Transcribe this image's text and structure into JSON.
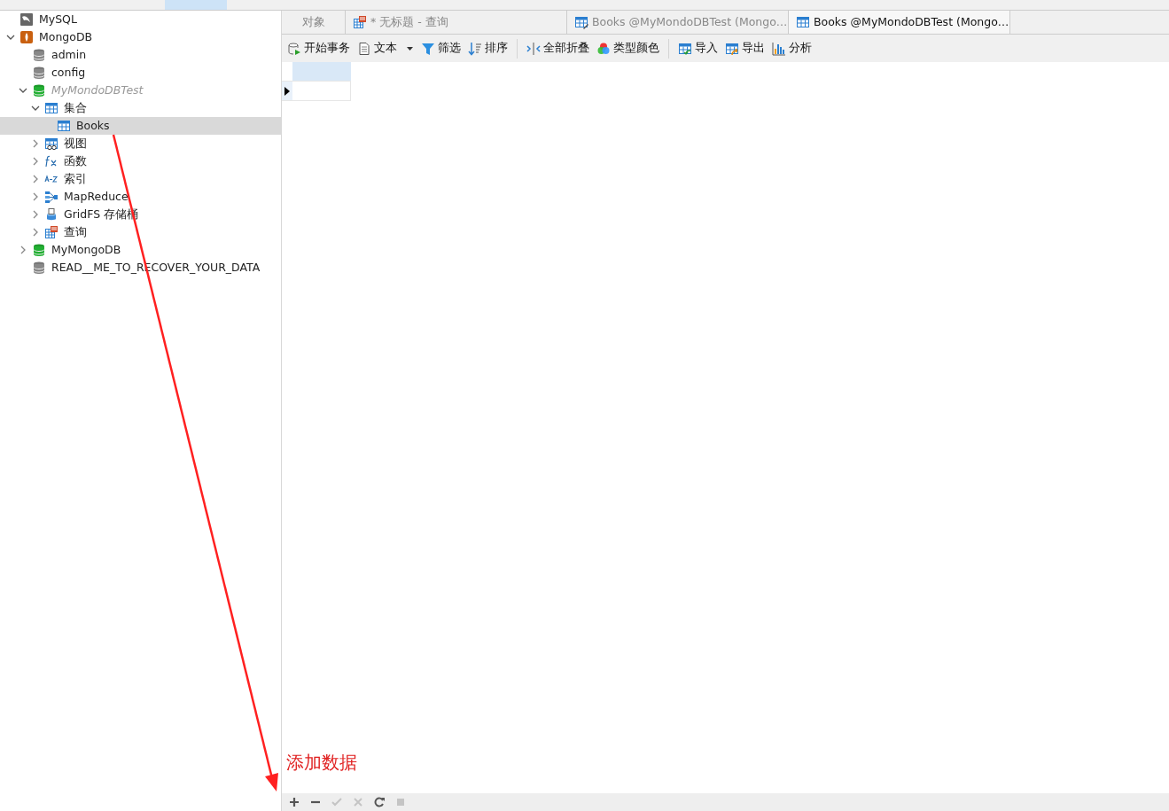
{
  "tree": [
    {
      "label": "MySQL",
      "kind": "mysql"
    },
    {
      "label": "MongoDB",
      "kind": "mongo",
      "expanded": true,
      "children": [
        {
          "label": "admin",
          "kind": "db"
        },
        {
          "label": "config",
          "kind": "db"
        },
        {
          "label": "MyMondoDBTest",
          "kind": "db-open",
          "dimmed": true,
          "expanded": true,
          "children": [
            {
              "label": "集合",
              "kind": "table",
              "expanded": true,
              "children": [
                {
                  "label": "Books",
                  "kind": "table",
                  "selected": true
                }
              ]
            },
            {
              "label": "视图",
              "kind": "view",
              "expanded": false
            },
            {
              "label": "函数",
              "kind": "function",
              "expanded": false
            },
            {
              "label": "索引",
              "kind": "index",
              "expanded": false
            },
            {
              "label": "MapReduce",
              "kind": "mapreduce",
              "expanded": false
            },
            {
              "label": "GridFS 存储桶",
              "kind": "gridfs",
              "expanded": false
            },
            {
              "label": "查询",
              "kind": "query",
              "expanded": false
            }
          ]
        },
        {
          "label": "MyMongoDB",
          "kind": "db-open",
          "expanded": false
        },
        {
          "label": "READ__ME_TO_RECOVER_YOUR_DATA",
          "kind": "db"
        }
      ]
    }
  ],
  "tabs": [
    {
      "label": "对象",
      "kind": "plain",
      "selected": false
    },
    {
      "label": "* 无标题 - 查询",
      "kind": "query",
      "selected": false
    },
    {
      "label": "Books @MyMondoDBTest (Mongo…",
      "kind": "table-edit",
      "selected": false
    },
    {
      "label": "Books @MyMondoDBTest (Mongo…",
      "kind": "table",
      "selected": true
    }
  ],
  "toolbar": [
    {
      "label": "开始事务",
      "kind": "transaction"
    },
    {
      "label": "文本",
      "kind": "text",
      "dropdown": true
    },
    {
      "label": "筛选",
      "kind": "filter"
    },
    {
      "label": "排序",
      "kind": "sort",
      "separator_after": true
    },
    {
      "label": "全部折叠",
      "kind": "collapse"
    },
    {
      "label": "类型颜色",
      "kind": "color",
      "separator_after": true
    },
    {
      "label": "导入",
      "kind": "import"
    },
    {
      "label": "导出",
      "kind": "export"
    },
    {
      "label": "分析",
      "kind": "chart"
    }
  ],
  "bottom_buttons": [
    {
      "kind": "add",
      "disabled": false
    },
    {
      "kind": "remove",
      "disabled": false
    },
    {
      "kind": "apply",
      "disabled": true
    },
    {
      "kind": "discard",
      "disabled": true
    },
    {
      "kind": "refresh",
      "disabled": false
    },
    {
      "kind": "stop",
      "disabled": true
    }
  ],
  "annotation": {
    "text": "添加数据"
  }
}
